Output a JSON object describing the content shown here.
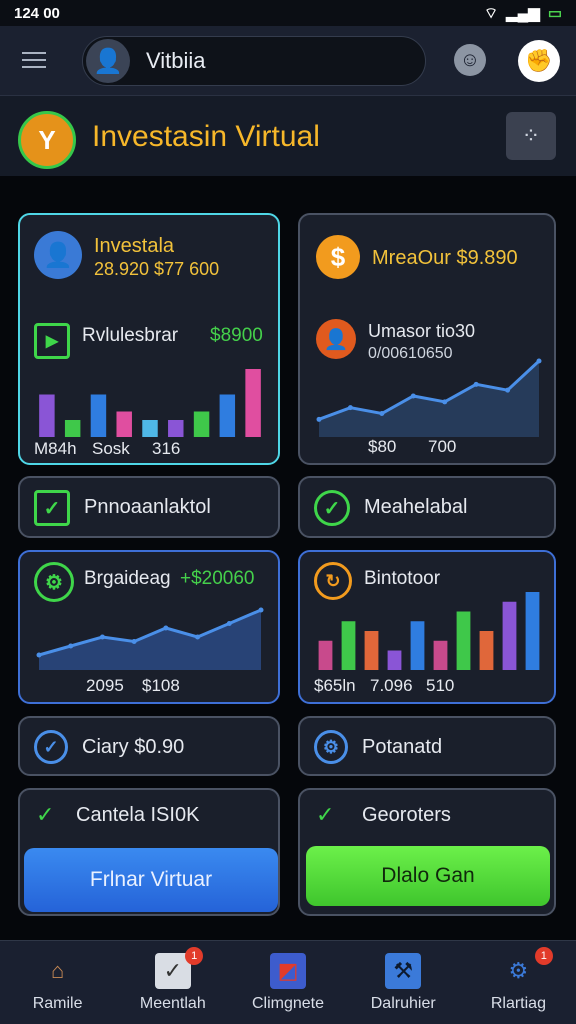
{
  "status": {
    "time": "124 00",
    "icons": [
      "wifi-icon",
      "signal-icon",
      "battery-icon"
    ]
  },
  "topbar": {
    "profile_name": "Vitbiia"
  },
  "header": {
    "title": "Investasin Virtual"
  },
  "cards": {
    "investala": {
      "title": "Investala",
      "amounts": "28.920 $77 600",
      "subtitle": "Rvlulesbrar",
      "subvalue": "$8900",
      "axis": [
        "M84h",
        "Sosk",
        "316"
      ]
    },
    "mreaour": {
      "title": "MreaOur $9.890",
      "subtitle": "Umasor tio30",
      "subvalue": "0/00610650",
      "axis": [
        "$80",
        "700"
      ]
    },
    "pnnoanlaktol": {
      "label": "Pnnoaanlaktol"
    },
    "meahelabal": {
      "label": "Meahelabal"
    },
    "brgaideag": {
      "title": "Brgaideag",
      "value": "+$20060",
      "axis": [
        "2095",
        "$108"
      ]
    },
    "bintotoor": {
      "title": "Bintotoor",
      "axis": [
        "$65ln",
        "7.096",
        "510"
      ]
    },
    "ciary": {
      "label": "Ciary $0.90"
    },
    "potanatd": {
      "label": "Potanatd"
    },
    "cantela": {
      "label": "Cantela ISI0K"
    },
    "georoters": {
      "label": "Georoters"
    }
  },
  "buttons": {
    "primary": "Frlnar Virtuar",
    "secondary": "Dlalo Gan"
  },
  "nav": [
    {
      "label": "Ramile"
    },
    {
      "label": "Meentlah",
      "badge": "1"
    },
    {
      "label": "Climgnete"
    },
    {
      "label": "Dalruhier"
    },
    {
      "label": "Rlartiag",
      "badge": "1"
    }
  ],
  "chart_data": [
    {
      "type": "bar",
      "values": [
        5,
        2,
        5,
        3,
        2,
        2,
        3,
        5,
        8
      ]
    },
    {
      "type": "line",
      "values": [
        1,
        2,
        1.5,
        3,
        2.5,
        4,
        3.5,
        6
      ]
    },
    {
      "type": "line",
      "values": [
        1,
        2,
        3,
        2.5,
        4,
        3,
        4.5,
        6
      ]
    },
    {
      "type": "bar",
      "values": [
        3,
        5,
        4,
        2,
        5,
        3,
        6,
        4,
        7,
        8
      ]
    }
  ]
}
